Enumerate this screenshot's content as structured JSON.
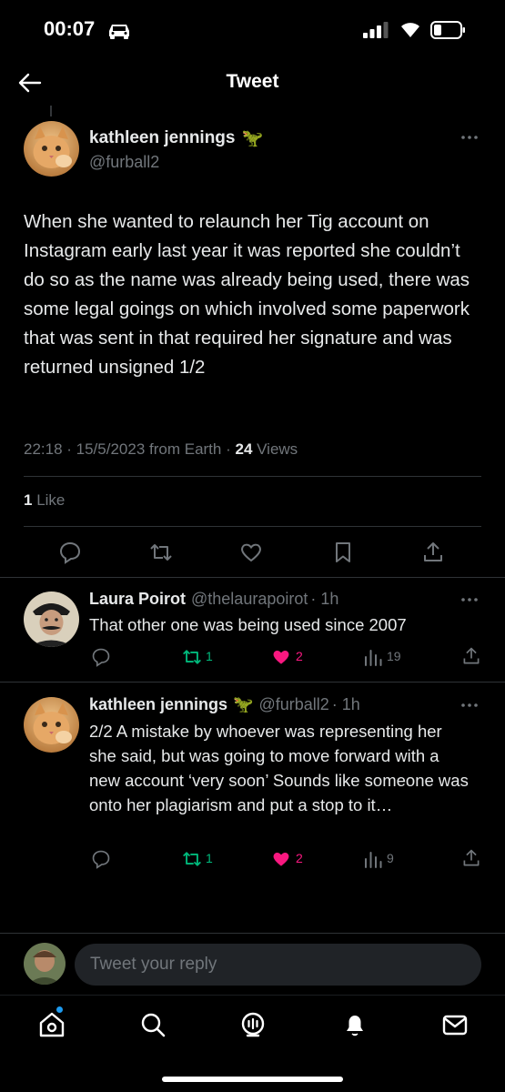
{
  "status_bar": {
    "time": "00:07"
  },
  "nav": {
    "title": "Tweet"
  },
  "main_tweet": {
    "display_name": "kathleen jennings",
    "emoji": "🦖",
    "handle": "@furball2",
    "text": "When she wanted to relaunch her Tig account on Instagram early last year it was reported she couldn’t do so as the name was already being used, there was some legal goings on which involved some paperwork that was sent in that required her signature and was returned unsigned 1/2",
    "timestamp": "22:18 · 15/5/2023 from Earth ·",
    "views_count": "24",
    "views_label": "Views",
    "likes_count": "1",
    "likes_label": "Like"
  },
  "replies": [
    {
      "display_name": "Laura Poirot",
      "handle": "@thelaurapoirot",
      "time": "· 1h",
      "text": "That other one was being used since 2007",
      "retweets": "1",
      "likes": "2",
      "views": "19"
    },
    {
      "display_name": "kathleen jennings",
      "emoji": "🦖",
      "handle": "@furball2",
      "time": "· 1h",
      "text": "2/2 A mistake by whoever was representing her she said, but was going to move forward with a new account ‘very soon’ Sounds like someone was onto her plagiarism and put a stop to it…",
      "retweets": "1",
      "likes": "2",
      "views": "9"
    }
  ],
  "composer": {
    "placeholder": "Tweet your reply"
  },
  "colors": {
    "retweet": "#00ba7c",
    "like": "#f91880",
    "muted": "#71767b",
    "accent": "#1d9bf0"
  },
  "icons": {
    "status": [
      "car-icon",
      "signal-icon",
      "wifi-icon",
      "battery-icon"
    ],
    "nav": [
      "back-arrow-icon"
    ],
    "actions": [
      "reply-icon",
      "retweet-icon",
      "like-icon",
      "bookmark-icon",
      "share-icon",
      "views-icon"
    ],
    "tabs": [
      "home-icon",
      "search-icon",
      "spaces-icon",
      "notifications-icon",
      "messages-icon"
    ]
  }
}
